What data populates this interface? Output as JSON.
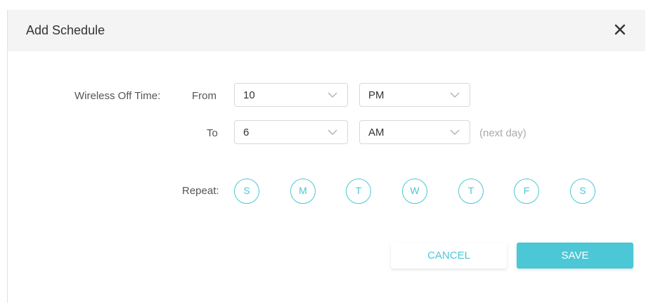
{
  "dialog": {
    "title": "Add Schedule",
    "close_icon": "close-icon"
  },
  "wireless_off": {
    "label": "Wireless Off Time:",
    "from_label": "From",
    "to_label": "To",
    "from_hour": "10",
    "from_period": "PM",
    "to_hour": "6",
    "to_period": "AM",
    "next_day_note": "(next day)",
    "dropdown_icon": "chevron-down-icon"
  },
  "repeat": {
    "label": "Repeat:",
    "days": [
      "S",
      "M",
      "T",
      "W",
      "T",
      "F",
      "S"
    ]
  },
  "actions": {
    "cancel_label": "CANCEL",
    "save_label": "SAVE"
  },
  "colors": {
    "accent": "#4cc7d6",
    "header_bg": "#f4f4f4",
    "text": "#555555",
    "muted": "#aaaaaa"
  }
}
